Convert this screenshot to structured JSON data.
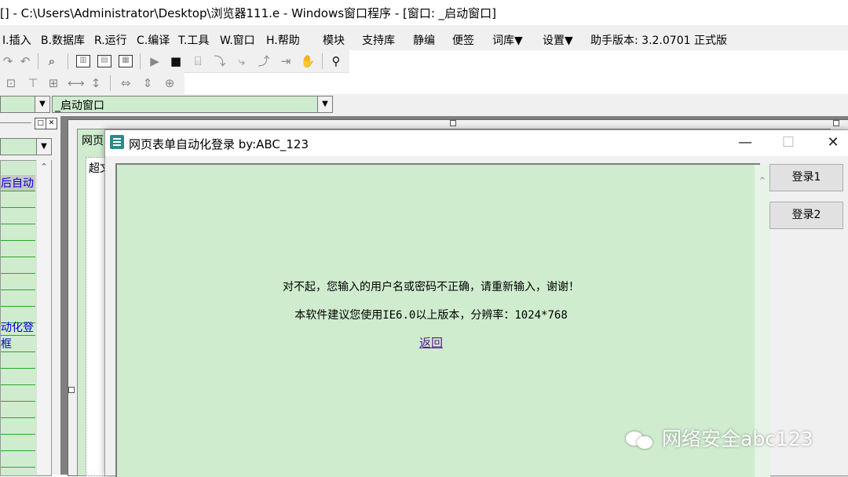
{
  "ide": {
    "title": "[] - C:\\Users\\Administrator\\Desktop\\浏览器111.e - Windows窗口程序 - [窗口: _启动窗口]"
  },
  "menu": [
    "I.插入",
    "B.数据库",
    "R.运行",
    "C.编译",
    "T.工具",
    "W.窗口",
    "H.帮助",
    "模块",
    "支持库",
    "静编",
    "便签",
    "词库▼",
    "设置▼",
    "助手版本: 3.2.0701 正式版"
  ],
  "combo": {
    "window_selector": "_启动窗口"
  },
  "left_panel": {
    "items": [
      "后自动",
      "",
      "",
      "",
      "",
      "",
      "",
      "",
      "",
      "动化登",
      "框",
      "",
      "",
      "",
      "",
      "",
      "",
      "",
      ""
    ]
  },
  "designer": {
    "tab_text": "网页",
    "inner_text": "超文"
  },
  "popup": {
    "title": "网页表单自动化登录 by:ABC_123",
    "controls": {
      "minimize": "—",
      "maximize": "☐",
      "close": "✕"
    },
    "message1": "对不起，您输入的用户名或密码不正确，请重新输入，谢谢！",
    "message2": "本软件建议您使用IE6.0以上版本，分辨率：1024*768",
    "back_link": "返回",
    "login1": "登录1",
    "login2": "登录2"
  },
  "watermark": {
    "text": "网络安全abc123"
  }
}
